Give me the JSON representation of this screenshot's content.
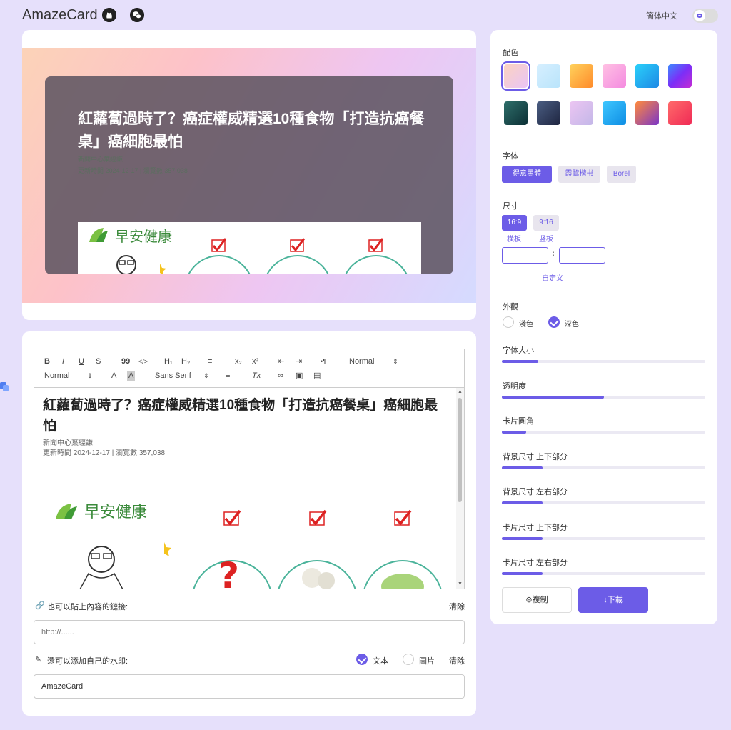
{
  "header": {
    "title": "AmazeCard",
    "language": "簡体中文"
  },
  "preview": {
    "card_title": "紅蘿蔔過時了？癌症權威精選10種食物「打造抗癌餐桌」癌細胞最怕",
    "meta_line1": "新聞中心葉經謙",
    "meta_line2": "更新時間 2024-12-17 | 瀏覽數 357,038",
    "brand": "早安健康",
    "watermark": "AmazeCard"
  },
  "editor": {
    "toolbar": {
      "bold": "B",
      "italic": "I",
      "underline": "U",
      "strike": "S",
      "quote": "99",
      "code": "</>",
      "h1": "H₁",
      "h2": "H₂",
      "list": "≡",
      "sub": "x₂",
      "sup": "x²",
      "outdent": "⇤",
      "indent": "⇥",
      "direction": "•¶",
      "size": "Normal",
      "header": "Normal",
      "font": "Sans Serif",
      "align": "≡",
      "clean": "Tx"
    },
    "title": "紅蘿蔔過時了？癌症權威精選10種食物「打造抗癌餐桌」癌細胞最怕",
    "meta_line1": "新聞中心葉經謙",
    "meta_line2": "更新時間 2024-12-17 | 瀏覽數 357,038",
    "brand": "早安健康"
  },
  "link": {
    "label": "也可以貼上內容的鏈接:",
    "clear": "清除",
    "placeholder": "http://......"
  },
  "watermark": {
    "label": "還可以添加自己的水印:",
    "option_text": "文本",
    "option_image": "圖片",
    "clear": "清除",
    "value": "AmazeCard"
  },
  "settings": {
    "color_label": "配色",
    "swatches": [
      "linear-gradient(135deg,#fcd3c0,#e9c4f6)",
      "linear-gradient(135deg,#d6efff,#b9e4fb)",
      "linear-gradient(135deg,#ffd25c,#ff8a2a)",
      "linear-gradient(135deg,#ffc1e3,#f48ae0)",
      "linear-gradient(135deg,#2ad0fa,#1e88e5)",
      "linear-gradient(135deg,#3d8aff,#7b2ff7,#c42bd4)",
      "linear-gradient(135deg,#2e6e6a,#0c2f35)",
      "linear-gradient(135deg,#4a5d82,#1e2540)",
      "linear-gradient(135deg,#ecc5f2,#c3b7e8)",
      "linear-gradient(135deg,#3fc7ff,#0d8de4)",
      "linear-gradient(135deg,#ff8a3d,#7b35c7)",
      "linear-gradient(135deg,#ff6a6a,#f02a55)"
    ],
    "font_label": "字体",
    "fonts": [
      "得意黑體",
      "霞鶩楷书",
      "Borel"
    ],
    "size_label": "尺寸",
    "ratios": [
      {
        "value": "16:9",
        "caption": "橫板"
      },
      {
        "value": "9:16",
        "caption": "竖板"
      }
    ],
    "ratio_sep": ":",
    "custom": "自定义",
    "appearance_label": "外觀",
    "light": "淺色",
    "dark": "深色",
    "sliders": [
      {
        "label": "字体大小",
        "value": 0.18
      },
      {
        "label": "透明度",
        "value": 0.5
      },
      {
        "label": "卡片圓角",
        "value": 0.12
      },
      {
        "label": "背景尺寸 上下部分",
        "value": 0.2
      },
      {
        "label": "背景尺寸 左右部分",
        "value": 0.2
      },
      {
        "label": "卡片尺寸 上下部分",
        "value": 0.2
      },
      {
        "label": "卡片尺寸 左右部分",
        "value": 0.2
      }
    ],
    "copy": "⊙複制",
    "download": "↓下載"
  },
  "colors": {
    "accent": "#6c5ce7",
    "page_bg": "#e6e0fb"
  }
}
